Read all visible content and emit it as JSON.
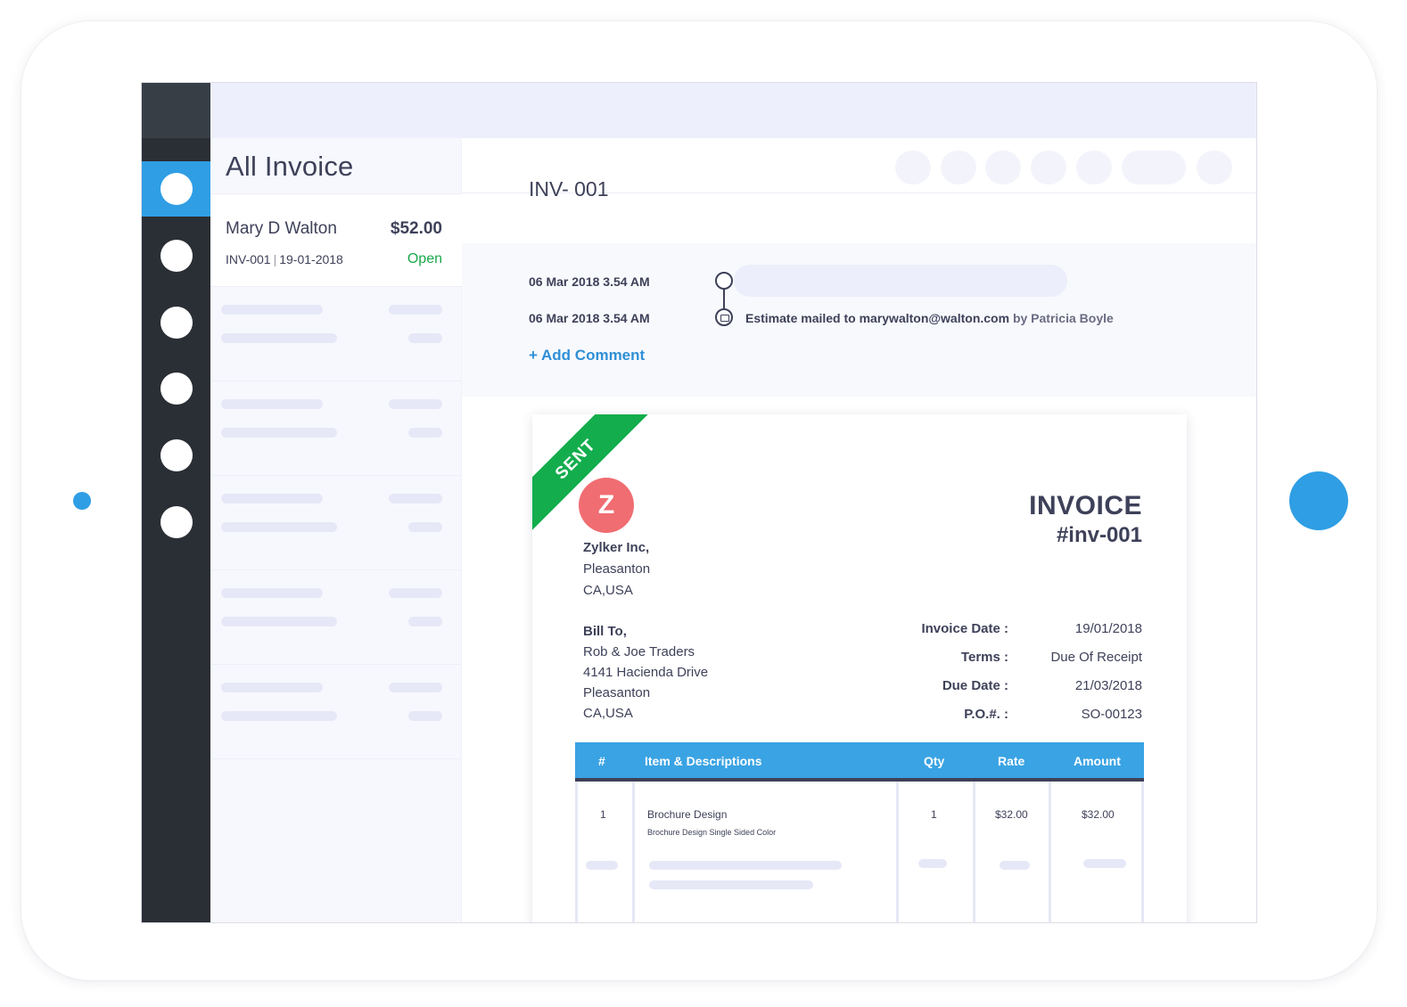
{
  "list": {
    "title": "All Invoice",
    "invoice": {
      "customer": "Mary D Walton",
      "amount": "$52.00",
      "number": "INV-001",
      "separator": "|",
      "date": "19-01-2018",
      "status": "Open"
    }
  },
  "detail": {
    "number": "INV- 001",
    "activity": [
      {
        "timestamp": "06 Mar 2018 3.54 AM"
      },
      {
        "timestamp": "06 Mar 2018 3.54 AM",
        "message": "Estimate mailed to marywalton@walton.com",
        "by": "by Patricia Boyle"
      }
    ],
    "add_comment": "+ Add Comment"
  },
  "invoice": {
    "ribbon": "SENT",
    "logo_letter": "Z",
    "from": {
      "company": "Zylker Inc,",
      "city": "Pleasanton",
      "region": "CA,USA"
    },
    "title": "INVOICE",
    "number": "#inv-001",
    "bill_to": {
      "label": "Bill To,",
      "name": "Rob & Joe Traders",
      "street": "4141 Hacienda Drive",
      "city": "Pleasanton",
      "region": "CA,USA"
    },
    "meta": [
      {
        "label": "Invoice Date :",
        "value": "19/01/2018"
      },
      {
        "label": "Terms :",
        "value": "Due Of Receipt"
      },
      {
        "label": "Due Date :",
        "value": "21/03/2018"
      },
      {
        "label": "P.O.#. :",
        "value": "SO-00123"
      }
    ],
    "columns": [
      "#",
      "Item & Descriptions",
      "Qty",
      "Rate",
      "Amount"
    ],
    "items": [
      {
        "index": "1",
        "name": "Brochure Design",
        "description": "Brochure Design Single Sided Color",
        "qty": "1",
        "rate": "$32.00",
        "amount": "$32.00"
      }
    ]
  },
  "colors": {
    "accent": "#2f9ee4",
    "nav_bg": "#2a2f35",
    "status_open": "#19a84a",
    "ribbon": "#13ad4d",
    "logo": "#f06d72",
    "table_header": "#3aa3e3"
  }
}
